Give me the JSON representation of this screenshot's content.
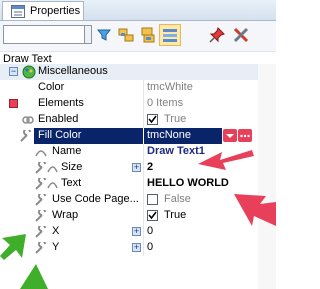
{
  "tab": {
    "label": "Properties"
  },
  "toolbar": {
    "search_value": "",
    "buttons": [
      "filter-icon",
      "categorized-icon",
      "alphabetical-icon",
      "view-icon",
      "pin-icon",
      "tools-icon"
    ]
  },
  "object_name": "Draw Text",
  "rows": [
    {
      "name": "Miscellaneous"
    },
    {
      "name": "Color",
      "value": "tmcWhite"
    },
    {
      "name": "Elements",
      "value": "0 Items"
    },
    {
      "name": "Enabled",
      "value": "True"
    },
    {
      "name": "Fill Color",
      "value": "tmcNone"
    },
    {
      "name": "Name",
      "value": "Draw Text1"
    },
    {
      "name": "Size",
      "value": "2"
    },
    {
      "name": "Text",
      "value": "HELLO WORLD"
    },
    {
      "name": "Use Code Page...",
      "value": "False"
    },
    {
      "name": "Wrap",
      "value": "True"
    },
    {
      "name": "X",
      "value": "0"
    },
    {
      "name": "Y",
      "value": "0"
    }
  ],
  "colors": {
    "selection": "#0a246a",
    "annotation_red": "#e8405a",
    "annotation_green": "#3fae2a"
  }
}
